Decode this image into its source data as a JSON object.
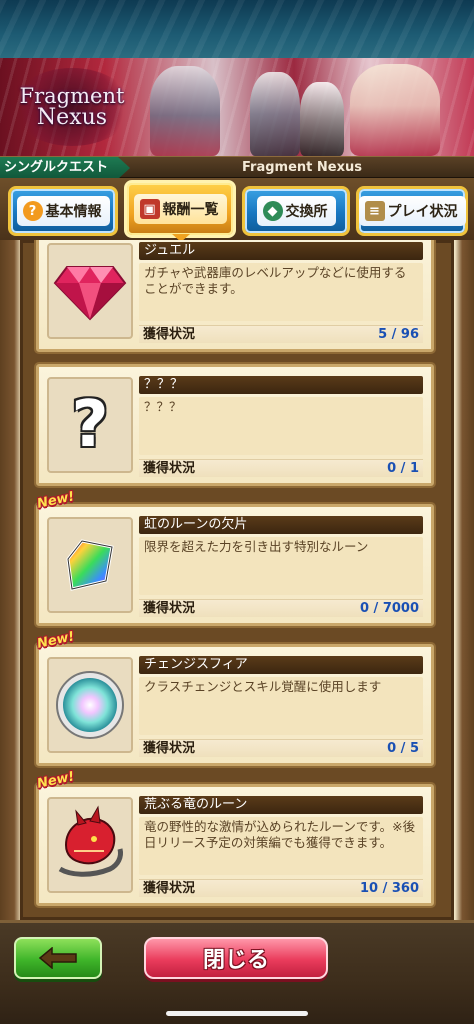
{
  "banner": {
    "logo_line1": "Fragment",
    "logo_line2": "Nexus"
  },
  "header": {
    "breadcrumb": "シングルクエスト",
    "title": "Fragment Nexus"
  },
  "tabs": [
    {
      "label": "基本情報",
      "icon": "question-icon",
      "color": "#f29a1f"
    },
    {
      "label": "報酬一覧",
      "icon": "treasure-chest-icon",
      "color": "#c0392b",
      "active": true
    },
    {
      "label": "交換所",
      "icon": "gems-icon",
      "color": "#2e8b57"
    },
    {
      "label": "プレイ状況",
      "icon": "scroll-icon",
      "color": "#b08d4a"
    }
  ],
  "items": [
    {
      "name": "ジュエル",
      "desc": "ガチャや武器庫のレベルアップなどに使用することができます。",
      "status_label": "獲得状況",
      "status_value": "5 / 96",
      "icon": "jewel-icon",
      "is_new": false
    },
    {
      "name": "？？？",
      "desc": "？？？",
      "status_label": "獲得状況",
      "status_value": "0 / 1",
      "icon": "question-mark-icon",
      "is_new": false
    },
    {
      "name": "虹のルーンの欠片",
      "desc": "限界を超えた力を引き出す特別なルーン",
      "status_label": "獲得状況",
      "status_value": "0 / 7000",
      "icon": "rainbow-rune-icon",
      "is_new": true
    },
    {
      "name": "チェンジスフィア",
      "desc": "クラスチェンジとスキル覚醒に使用します",
      "status_label": "獲得状況",
      "status_value": "0 / 5",
      "icon": "sphere-icon",
      "is_new": true
    },
    {
      "name": "荒ぶる竜のルーン",
      "desc": "竜の野性的な激情が込められたルーンです。※後日リリース予定の対策編でも獲得できます。",
      "status_label": "獲得状況",
      "status_value": "10 / 360",
      "icon": "dragon-rune-icon",
      "is_new": true
    }
  ],
  "new_badge": "New!",
  "footer": {
    "close_label": "閉じる",
    "back_icon": "back-arrow-icon"
  }
}
